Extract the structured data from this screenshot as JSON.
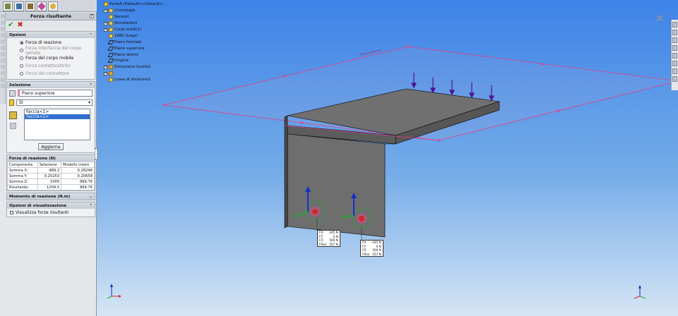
{
  "tree": {
    "root": "Parte4 (Default<<Default>...",
    "nodes": [
      "Cronologia",
      "Sensori",
      "Annotazioni",
      "Corpi solidi(1)",
      "1060 (Lega)",
      "Piano frontale",
      "Piano superiore",
      "Piano destro",
      "Origine",
      "Estrusione-Svolta1",
      "",
      "Linea di divisione1"
    ]
  },
  "panel": {
    "title": "Forza risultante",
    "help": "?",
    "opzioni": {
      "header": "Opzioni",
      "options": [
        {
          "label": "Forza di reazione",
          "enabled": true,
          "selected": true
        },
        {
          "label": "Forza interfaccia del corpo remoto",
          "enabled": false,
          "selected": false
        },
        {
          "label": "Forza del corpo mobile",
          "enabled": true,
          "selected": false
        },
        {
          "label": "Forza contatto/attrito",
          "enabled": false,
          "selected": false
        },
        {
          "label": "Forza del connettore",
          "enabled": false,
          "selected": false
        }
      ]
    },
    "selezione": {
      "header": "Selezione",
      "plane": "Piano superiore",
      "unit": "SI",
      "faces": [
        "Faccia<1>",
        "Faccia<2>"
      ],
      "update_button": "Aggiorna"
    },
    "forza": {
      "header": "Forza di reazione (N)",
      "columns": [
        "Componente",
        "Selezione",
        "Modello intero"
      ],
      "rows": [
        [
          "Somma X:",
          "489.2",
          "0.28246"
        ],
        [
          "Somma Y:",
          "0.25253",
          "0.20658"
        ],
        [
          "Somma Z:",
          "1000",
          "999.76"
        ],
        [
          "Risultante:",
          "1204.5",
          "999.76"
        ]
      ]
    },
    "momento": {
      "header": "Momento di reazione (N.m)"
    },
    "visual": {
      "header": "Opzioni di visualizzazione",
      "checkbox": "Visualizza forze risultanti"
    }
  },
  "labels": {
    "left": [
      [
        "FX:",
        "-245 N"
      ],
      [
        "FY:",
        "0 N"
      ],
      [
        "FZ:",
        "500 N"
      ],
      [
        "FRes:",
        "557 N"
      ]
    ],
    "right": [
      [
        "FX:",
        "-245 N"
      ],
      [
        "FY:",
        "0 N"
      ],
      [
        "FZ:",
        "500 N"
      ],
      [
        "FRes:",
        "557 N"
      ]
    ]
  },
  "plane_label": "Piano superiore",
  "triad": {
    "x": "x",
    "y": "y",
    "z": "z"
  },
  "colors": {
    "accent": "#2f6fd0",
    "plane": "#e0408a",
    "ok": "#1a9b1a",
    "cancel": "#d41b1b",
    "arrow": "#4b1296"
  }
}
